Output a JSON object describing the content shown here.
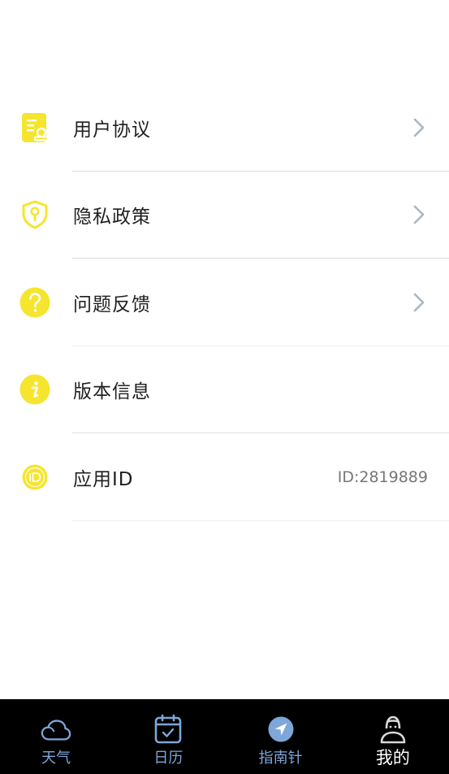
{
  "menu": {
    "items": [
      {
        "label": "用户协议",
        "icon": "user-agreement-icon",
        "has_chevron": true
      },
      {
        "label": "隐私政策",
        "icon": "privacy-shield-icon",
        "has_chevron": true
      },
      {
        "label": "问题反馈",
        "icon": "question-icon",
        "has_chevron": true
      },
      {
        "label": "版本信息",
        "icon": "info-icon",
        "has_chevron": false
      },
      {
        "label": "应用ID",
        "icon": "id-icon",
        "value": "ID:2819889",
        "has_chevron": false
      }
    ]
  },
  "tabbar": {
    "tabs": [
      {
        "label": "天气",
        "icon": "cloud-icon",
        "active": false
      },
      {
        "label": "日历",
        "icon": "calendar-icon",
        "active": false
      },
      {
        "label": "指南针",
        "icon": "compass-icon",
        "active": false
      },
      {
        "label": "我的",
        "icon": "profile-icon",
        "active": true
      }
    ]
  },
  "colors": {
    "accent_yellow": "#f5e52f",
    "chevron": "#a9b6c4",
    "tab_inactive": "#7ea6d8",
    "tab_active": "#ffffff",
    "tabbar_bg": "#000000"
  }
}
